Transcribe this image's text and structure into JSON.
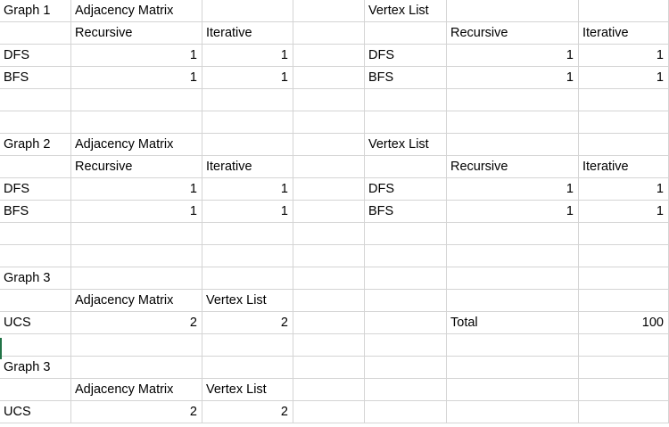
{
  "spreadsheet": {
    "rows": [
      [
        "Graph 1",
        "Adjacency Matrix",
        "",
        "",
        "Vertex List",
        "",
        ""
      ],
      [
        "",
        "Recursive",
        "Iterative",
        "",
        "",
        "Recursive",
        "Iterative"
      ],
      [
        "DFS",
        "1",
        "1",
        "",
        "DFS",
        "1",
        "1"
      ],
      [
        "BFS",
        "1",
        "1",
        "",
        "BFS",
        "1",
        "1"
      ],
      [
        "",
        "",
        "",
        "",
        "",
        "",
        ""
      ],
      [
        "",
        "",
        "",
        "",
        "",
        "",
        ""
      ],
      [
        "Graph 2",
        "Adjacency Matrix",
        "",
        "",
        "Vertex List",
        "",
        ""
      ],
      [
        "",
        "Recursive",
        "Iterative",
        "",
        "",
        "Recursive",
        "Iterative"
      ],
      [
        "DFS",
        "1",
        "1",
        "",
        "DFS",
        "1",
        "1"
      ],
      [
        "BFS",
        "1",
        "1",
        "",
        "BFS",
        "1",
        "1"
      ],
      [
        "",
        "",
        "",
        "",
        "",
        "",
        ""
      ],
      [
        "",
        "",
        "",
        "",
        "",
        "",
        ""
      ],
      [
        "Graph 3",
        "",
        "",
        "",
        "",
        "",
        ""
      ],
      [
        "",
        "Adjacency Matrix",
        "Vertex List",
        "",
        "",
        "",
        ""
      ],
      [
        "UCS",
        "2",
        "2",
        "",
        "",
        "Total",
        "100"
      ],
      [
        "",
        "",
        "",
        "",
        "",
        "",
        ""
      ],
      [
        "Graph 3",
        "",
        "",
        "",
        "",
        "",
        ""
      ],
      [
        "",
        "Adjacency Matrix",
        "Vertex List",
        "",
        "",
        "",
        ""
      ],
      [
        "UCS",
        "2",
        "2",
        "",
        "",
        "",
        ""
      ]
    ],
    "numeric_columns": [
      1,
      2,
      5,
      6
    ],
    "colors": {
      "gridline": "#d4d4d4",
      "text": "#000000",
      "selection_accent": "#217346"
    }
  }
}
